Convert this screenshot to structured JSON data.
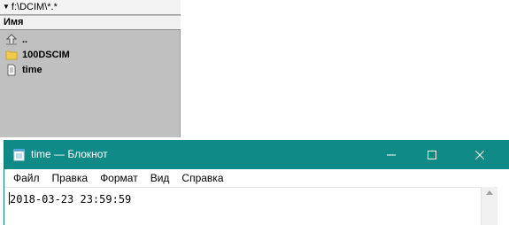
{
  "file_manager": {
    "path": "f:\\DCIM\\*.*",
    "column_header": "Имя",
    "items": [
      {
        "label": "..",
        "icon": "up-folder-icon"
      },
      {
        "label": "100DSCIM",
        "icon": "folder-icon"
      },
      {
        "label": "time",
        "icon": "text-file-icon"
      }
    ]
  },
  "notepad": {
    "title": "time — Блокнот",
    "menu": [
      "Файл",
      "Правка",
      "Формат",
      "Вид",
      "Справка"
    ],
    "content": "2018-03-23 23:59:59"
  },
  "colors": {
    "titlebar": "#0f8a86",
    "panel_bg": "#c0c0c0",
    "folder": "#f2c94c"
  }
}
